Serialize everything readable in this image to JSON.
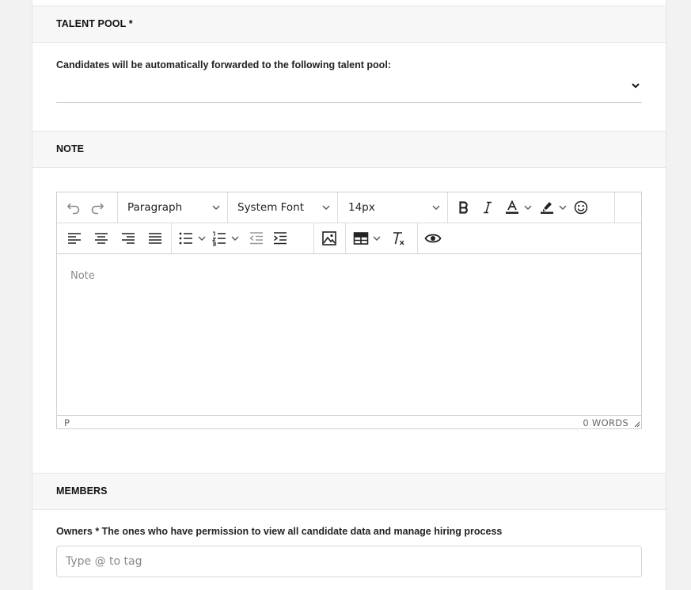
{
  "talent_pool": {
    "heading": "TALENT POOL *",
    "description": "Candidates will be automatically forwarded to the following talent pool:",
    "selected_value": ""
  },
  "note": {
    "heading": "NOTE",
    "toolbar": {
      "block_format": "Paragraph",
      "font_family": "System Font",
      "font_size": "14px"
    },
    "placeholder": "Note",
    "status_path": "P",
    "word_count": "0 WORDS"
  },
  "members": {
    "heading": "MEMBERS",
    "owners_label": "Owners * The ones who have permission to view all candidate data and manage hiring process",
    "owners_placeholder": "Type @ to tag"
  },
  "icons": [
    "undo-icon",
    "redo-icon",
    "bold-icon",
    "italic-icon",
    "text-color-icon",
    "highlight-icon",
    "emoji-icon",
    "align-left-icon",
    "align-center-icon",
    "align-right-icon",
    "justify-icon",
    "bullet-list-icon",
    "numbered-list-icon",
    "outdent-icon",
    "indent-icon",
    "image-icon",
    "table-icon",
    "clear-format-icon",
    "preview-icon"
  ]
}
